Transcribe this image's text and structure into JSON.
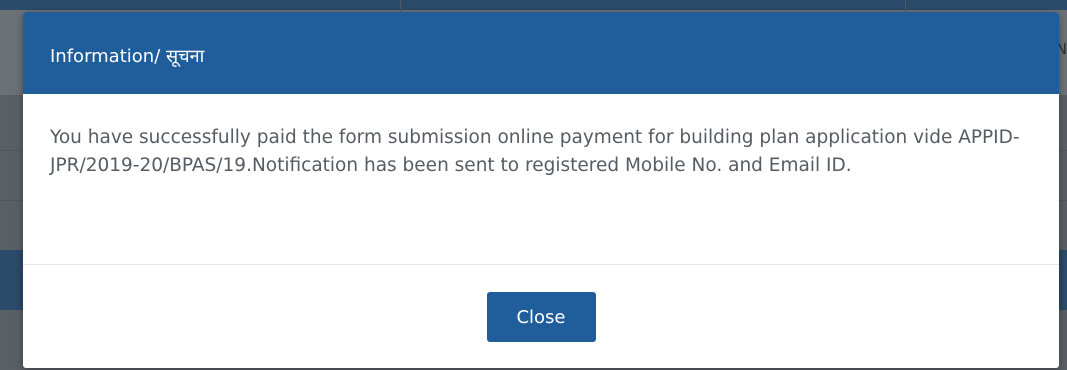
{
  "modal": {
    "title": "Information/ सूचना",
    "message": "You have successfully paid the form submission online payment for building plan application vide APPID- JPR/2019-20/BPAS/19.Notification has been sent to registered Mobile No. and Email ID.",
    "close_label": "Close"
  },
  "background": {
    "edge_text": "N"
  },
  "colors": {
    "header": "#1f5d9b",
    "button": "#1f5d9b",
    "overlay": "#5a5f66"
  }
}
